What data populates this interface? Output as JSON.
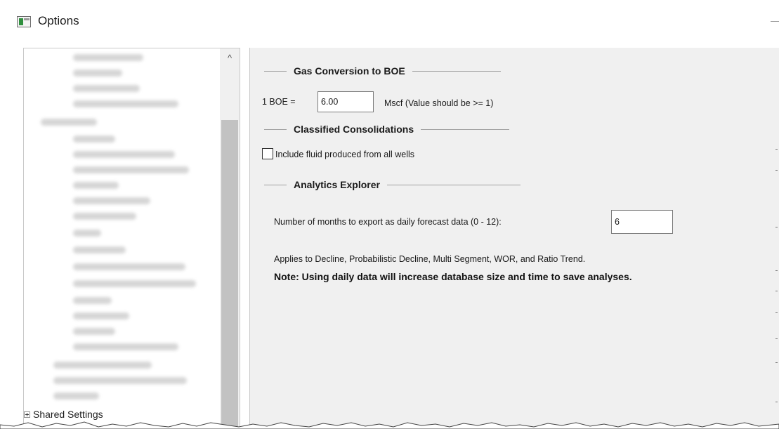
{
  "window": {
    "title": "Options"
  },
  "tree": {
    "scroll_up_glyph": "^",
    "visible_node": "Shared Settings"
  },
  "gas_conversion": {
    "heading": "Gas Conversion to BOE",
    "boe_label": "1 BOE =",
    "boe_value": "6.00",
    "unit_note": "Mscf (Value should be >= 1)"
  },
  "classified_consolidations": {
    "heading": "Classified Consolidations",
    "include_fluid_label": "Include fluid produced from all wells",
    "include_fluid_checked": false
  },
  "analytics_explorer": {
    "heading": "Analytics Explorer",
    "months_label": "Number of months to export as daily forecast data (0 - 12):",
    "months_value": "6",
    "applies_text": "Applies to Decline, Probabilistic Decline, Multi Segment, WOR, and Ratio Trend.",
    "note_text": "Note: Using daily data will increase database size and time to save analyses."
  },
  "colors": {
    "panel_bg": "#f0f0f0",
    "scroll_thumb": "#c2c2c2",
    "icon_green": "#2f8f3e"
  },
  "icons": {
    "app": "options-window-icon",
    "scroll_up": "chevron-up-icon",
    "expand": "plus-box-icon"
  }
}
